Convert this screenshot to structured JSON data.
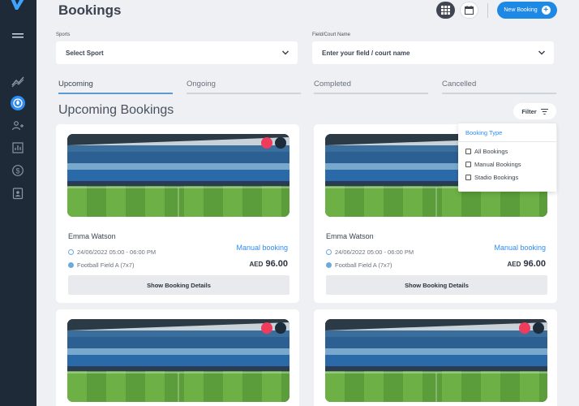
{
  "header": {
    "title": "Bookings",
    "new_booking_label": "New Booking"
  },
  "sidebar": {
    "items": [
      {
        "icon": "menu-icon"
      },
      {
        "icon": "trend-icon"
      },
      {
        "icon": "sport-ball-icon",
        "active": true
      },
      {
        "icon": "users-icon"
      },
      {
        "icon": "report-icon"
      },
      {
        "icon": "dollar-icon"
      },
      {
        "icon": "badge-icon"
      }
    ]
  },
  "filters": {
    "sports_label": "Sports",
    "sports_value": "Select Sport",
    "field_label": "Field/Court Name",
    "field_placeholder": "Enter your field / court name"
  },
  "tabs": [
    {
      "label": "Upcoming",
      "active": true
    },
    {
      "label": "Ongoing"
    },
    {
      "label": "Completed"
    },
    {
      "label": "Cancelled"
    }
  ],
  "section_title": "Upcoming Bookings",
  "filter_button": "Filter",
  "filter_dropdown": {
    "title": "Booking Type",
    "options": [
      "All Bookings",
      "Manual Bookings",
      "Stadio Bookings"
    ]
  },
  "bookings": [
    {
      "name": "Emma Watson",
      "type": "Manual booking",
      "time": "24/06/2022 05:00 - 06:00 PM",
      "field": "Football Field A (7x7)",
      "currency": "AED",
      "price": "96.00",
      "details_label": "Show Booking Details"
    },
    {
      "name": "Emma Watson",
      "type": "Manual booking",
      "time": "24/06/2022 05:00 - 06:00 PM",
      "field": "Football Field A (7x7)",
      "currency": "AED",
      "price": "96.00",
      "details_label": "Show Booking Details"
    }
  ],
  "colors": {
    "sidebar": "#1f2a38",
    "accent": "#1e88e5",
    "manual_booking": "#2f8cf0",
    "badge_red": "#ef3b5c"
  }
}
